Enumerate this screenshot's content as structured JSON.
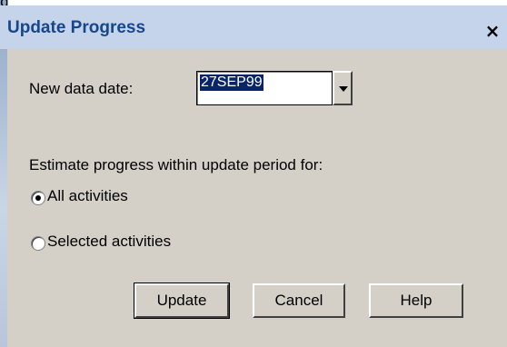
{
  "dialog": {
    "title": "Update Progress",
    "close_glyph": "×",
    "new_data_date_label": "New data date:",
    "new_data_date_value": "27SEP99",
    "estimate_label": "Estimate progress within update period for:",
    "options": [
      {
        "label": "All activities",
        "selected": true
      },
      {
        "label": "Selected activities",
        "selected": false
      }
    ],
    "buttons": {
      "update": "Update",
      "cancel": "Cancel",
      "help": "Help"
    }
  },
  "background": {
    "fragment_text": "g"
  }
}
